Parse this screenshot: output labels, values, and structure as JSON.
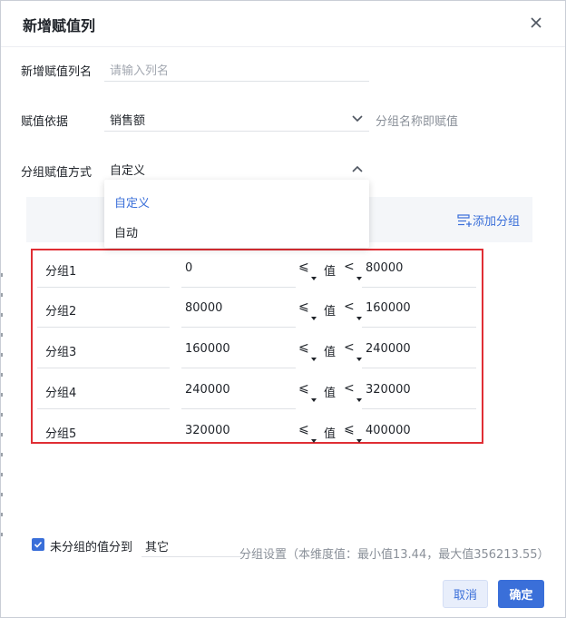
{
  "dialog": {
    "title": "新增赋值列",
    "close_icon": "close-icon"
  },
  "form": {
    "column_name_label": "新增赋值列名",
    "column_name_placeholder": "请输入列名",
    "basis_label": "赋值依据",
    "basis_value": "销售额",
    "basis_hint": "分组名称即赋值",
    "method_label": "分组赋值方式",
    "method_value": "自定义"
  },
  "method_dropdown": {
    "options": [
      {
        "label": "自定义",
        "selected": true
      },
      {
        "label": "自动",
        "selected": false
      }
    ]
  },
  "add_group_label": "添加分组",
  "groups": [
    {
      "name": "分组1",
      "min": "0",
      "op1": "⩽",
      "mid": "值",
      "op2": "<",
      "max": "80000"
    },
    {
      "name": "分组2",
      "min": "80000",
      "op1": "⩽",
      "mid": "值",
      "op2": "<",
      "max": "160000"
    },
    {
      "name": "分组3",
      "min": "160000",
      "op1": "⩽",
      "mid": "值",
      "op2": "<",
      "max": "240000"
    },
    {
      "name": "分组4",
      "min": "240000",
      "op1": "⩽",
      "mid": "值",
      "op2": "<",
      "max": "320000"
    },
    {
      "name": "分组5",
      "min": "320000",
      "op1": "⩽",
      "mid": "值",
      "op2": "⩽",
      "max": "400000"
    }
  ],
  "ungrouped": {
    "checked": true,
    "label": "未分组的值分到",
    "value": "其它"
  },
  "group_settings_info": "分组设置（本维度值：最小值13.44，最大值356213.55）",
  "buttons": {
    "cancel": "取消",
    "ok": "确定"
  },
  "colors": {
    "accent": "#3a6fd9",
    "highlight_box": "#e02e34"
  }
}
